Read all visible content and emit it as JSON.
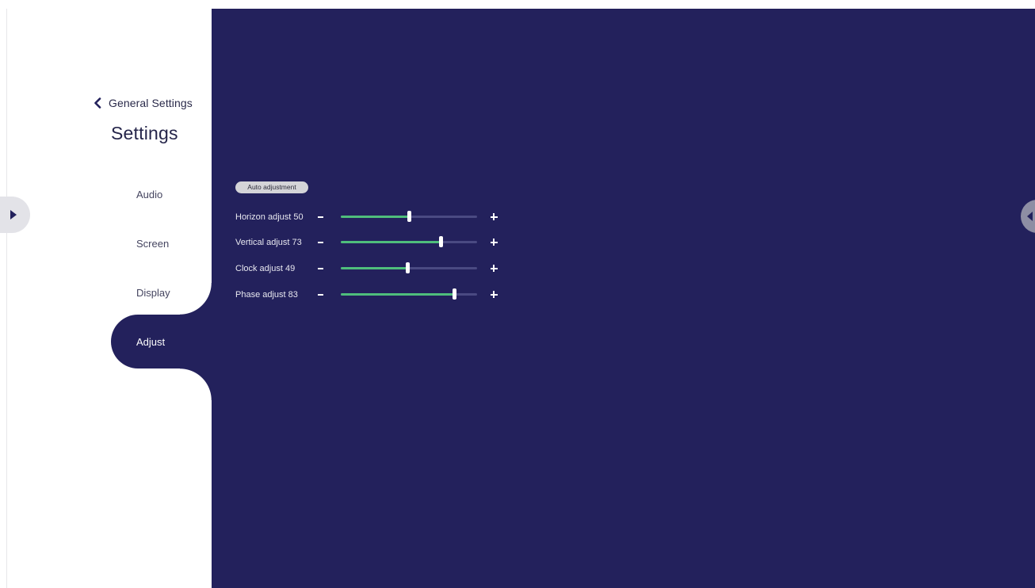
{
  "header": {
    "back_label": "General Settings",
    "title": "Settings"
  },
  "nav": {
    "items": [
      {
        "label": "Audio",
        "selected": false
      },
      {
        "label": "Screen",
        "selected": false
      },
      {
        "label": "Display",
        "selected": false
      },
      {
        "label": "Adjust",
        "selected": true
      }
    ]
  },
  "adjust": {
    "auto_button_label": "Auto adjustment",
    "sliders": [
      {
        "label": "Horizon adjust 50",
        "value": 50,
        "max": 100
      },
      {
        "label": "Vertical adjust 73",
        "value": 73,
        "max": 100
      },
      {
        "label": "Clock adjust 49",
        "value": 49,
        "max": 100
      },
      {
        "label": "Phase adjust 83",
        "value": 83,
        "max": 100
      }
    ]
  },
  "icons": {
    "back": "chevron-left-icon",
    "left_handle": "play-arrow-icon",
    "right_handle": "chevron-left-icon"
  },
  "colors": {
    "panel_background": "#23215c",
    "slider_fill": "#4fbe7c",
    "slider_track": "#4a4a82",
    "sidebar_background": "#ffffff"
  }
}
